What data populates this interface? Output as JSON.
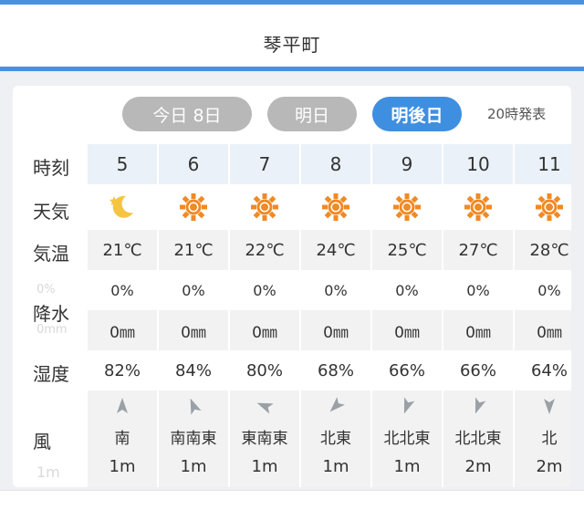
{
  "header": {
    "town": "琴平町"
  },
  "tabs": [
    {
      "label": "今日 8日",
      "state": "inactive"
    },
    {
      "label": "明日",
      "state": "inactive"
    },
    {
      "label": "明後日",
      "state": "active"
    }
  ],
  "issued": "20時発表",
  "row_labels": {
    "hour": "時刻",
    "weather": "天気",
    "temp": "気温",
    "precip": "降水",
    "humidity": "湿度",
    "wind": "風"
  },
  "ghost": {
    "precip_pct": "0%",
    "precip_mm": "0mm",
    "wind_speed": "1m"
  },
  "hours": [
    {
      "hour": "5",
      "weather": "moon-icon",
      "temp": "21℃",
      "precip_pct": "0%",
      "precip_mm": "0㎜",
      "humidity": "82%",
      "wind_dir": "南",
      "wind_speed": "1m"
    },
    {
      "hour": "6",
      "weather": "sun-icon",
      "temp": "21℃",
      "precip_pct": "0%",
      "precip_mm": "0㎜",
      "humidity": "84%",
      "wind_dir": "南南東",
      "wind_speed": "1m"
    },
    {
      "hour": "7",
      "weather": "sun-icon",
      "temp": "22℃",
      "precip_pct": "0%",
      "precip_mm": "0㎜",
      "humidity": "80%",
      "wind_dir": "東南東",
      "wind_speed": "1m"
    },
    {
      "hour": "8",
      "weather": "sun-icon",
      "temp": "24℃",
      "precip_pct": "0%",
      "precip_mm": "0㎜",
      "humidity": "68%",
      "wind_dir": "北東",
      "wind_speed": "1m"
    },
    {
      "hour": "9",
      "weather": "sun-icon",
      "temp": "25℃",
      "precip_pct": "0%",
      "precip_mm": "0㎜",
      "humidity": "66%",
      "wind_dir": "北北東",
      "wind_speed": "1m"
    },
    {
      "hour": "10",
      "weather": "sun-icon",
      "temp": "27℃",
      "precip_pct": "0%",
      "precip_mm": "0㎜",
      "humidity": "66%",
      "wind_dir": "北北東",
      "wind_speed": "2m"
    },
    {
      "hour": "11",
      "weather": "sun-icon",
      "temp": "28℃",
      "precip_pct": "0%",
      "precip_mm": "0㎜",
      "humidity": "64%",
      "wind_dir": "北",
      "wind_speed": "2m"
    }
  ],
  "colors": {
    "accent": "#3f8fe0",
    "sun": "#f08a24",
    "moon": "#f5c542"
  }
}
